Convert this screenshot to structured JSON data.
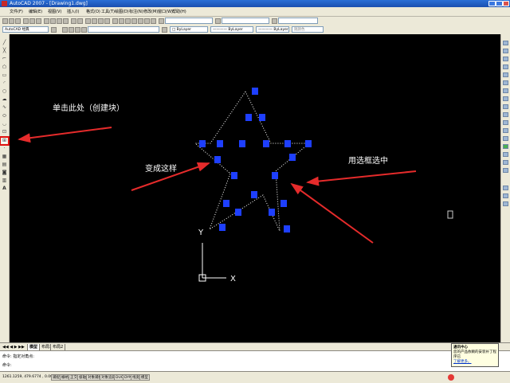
{
  "window": {
    "title": "AutoCAD 2007 - [Drawing1.dwg]"
  },
  "menu": [
    "文件(F)",
    "编辑(E)",
    "视图(V)",
    "插入(I)",
    "格式(O)",
    "工具(T)",
    "绘图(D)",
    "标注(N)",
    "修改(M)",
    "窗口(W)",
    "帮助(H)"
  ],
  "toolbar2": {
    "workspace": "AutoCAD 经典",
    "layer_combo": "",
    "color_combo": "□ ByLayer",
    "linetype_combo": "———— ByLayer",
    "lineweight_combo": "———— ByLayer",
    "plotstyle_combo": "随颜色"
  },
  "annotations": [
    {
      "text": "单击此处（创建块）",
      "color": "#ffffff"
    },
    {
      "text": "变成这样",
      "color": "#ffffff"
    },
    {
      "text": "用选框选中",
      "color": "#ffffff"
    }
  ],
  "ucs": {
    "y_label": "Y",
    "x_label": "X"
  },
  "layout_tabs": [
    "模型",
    "布局1",
    "布局2"
  ],
  "command": {
    "line1": "命令: 指定对角点:",
    "line2": "命令:"
  },
  "status": {
    "coords": "1261.1259,  479.6774 , 0.0000",
    "buttons": [
      "捕捉",
      "栅格",
      "正交",
      "极轴",
      "对象捕捉",
      "对象追踪",
      "DUCS",
      "DYN",
      "线宽",
      "模型"
    ]
  },
  "balloon": {
    "title": "通讯中心",
    "text": "您的产品依赖的安装补丁程序已",
    "link": "了解更多。"
  },
  "colors": {
    "grip": "#1e3fff",
    "canvas": "#000000",
    "arrow": "#e52b2b",
    "highlight": "#e01010"
  }
}
